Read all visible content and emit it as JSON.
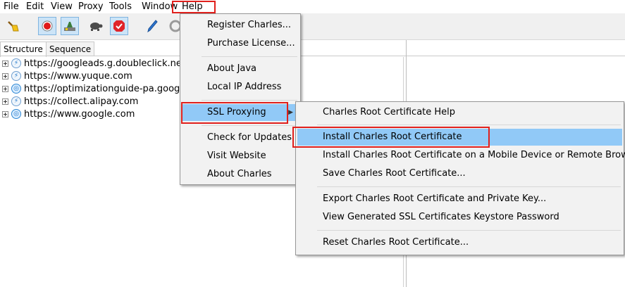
{
  "menubar": {
    "items": [
      "File",
      "Edit",
      "View",
      "Proxy",
      "Tools",
      "Window",
      "Help"
    ]
  },
  "toolbar": {
    "buttons": [
      "broom-icon",
      "record-icon",
      "throttle-icon",
      "turtle-icon",
      "breakpoint-check-icon",
      "pen-icon",
      "refresh-icon"
    ]
  },
  "tabs": [
    "Structure",
    "Sequence"
  ],
  "tree": [
    {
      "label": "https://googleads.g.doubleclick.net",
      "icon": "bolt-icon"
    },
    {
      "label": "https://www.yuque.com",
      "icon": "bolt-icon"
    },
    {
      "label": "https://optimizationguide-pa.googleapis.com",
      "icon": "globe-icon"
    },
    {
      "label": "https://collect.alipay.com",
      "icon": "bolt-icon"
    },
    {
      "label": "https://www.google.com",
      "icon": "globe-icon"
    }
  ],
  "help_menu": {
    "items": [
      "Register Charles...",
      "Purchase License...",
      "About Java",
      "Local IP Address",
      "SSL Proxying",
      "Check for Updates",
      "Visit Website",
      "About Charles"
    ],
    "selected": "SSL Proxying",
    "submenu_arrow": "▶"
  },
  "ssl_submenu": {
    "items": [
      "Charles Root Certificate Help",
      "Install Charles Root Certificate",
      "Install Charles Root Certificate on a Mobile Device or Remote Browser",
      "Save Charles Root Certificate...",
      "Export Charles Root Certificate and Private Key...",
      "View Generated SSL Certificates Keystore Password",
      "Reset Charles Root Certificate..."
    ],
    "selected": "Install Charles Root Certificate"
  },
  "colors": {
    "selection": "#91c9f7",
    "highlight_box": "#e0201c",
    "menu_bg": "#f2f2f2"
  }
}
